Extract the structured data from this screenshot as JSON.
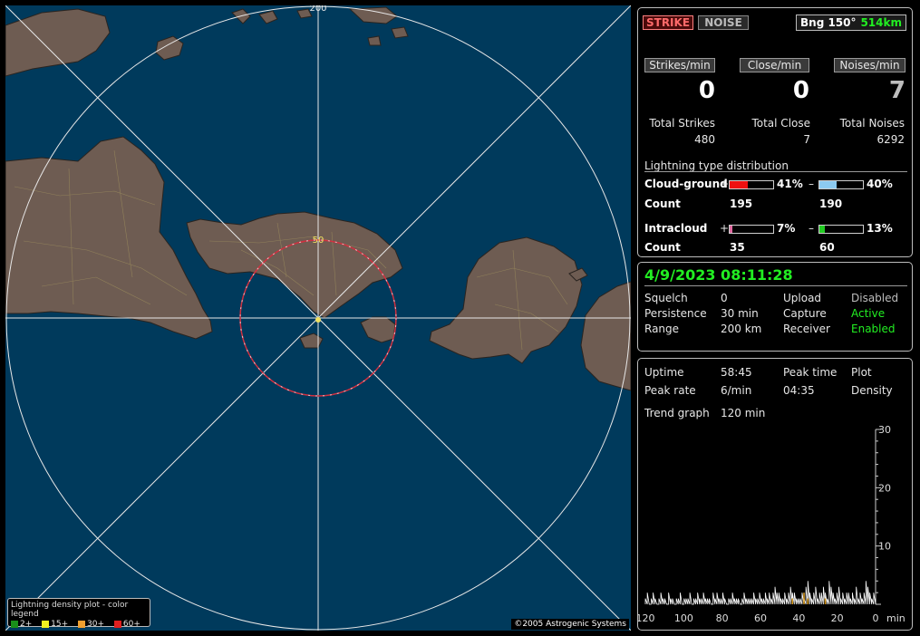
{
  "map": {
    "range_label_outer": "200",
    "range_label_inner": "50",
    "copyright": "©2005 Astrogenic Systems",
    "legend": {
      "title": "Lightning density plot - color legend",
      "items": [
        {
          "label": "2+",
          "color": "#1a8f1a"
        },
        {
          "label": "15+",
          "color": "#f0f020"
        },
        {
          "label": "30+",
          "color": "#f0a030"
        },
        {
          "label": "60+",
          "color": "#e02020"
        }
      ]
    },
    "colors": {
      "water": "#003a5c",
      "land": "#6e5c52",
      "inner_ring": "#d03040"
    }
  },
  "top": {
    "strike_label": "STRIKE",
    "noise_label": "NOISE",
    "bearing_text": "Bng 150°",
    "distance_text": "514km"
  },
  "rates": {
    "strikes_label": "Strikes/min",
    "close_label": "Close/min",
    "noises_label": "Noises/min",
    "strikes_value": "0",
    "close_value": "0",
    "noises_value": "7"
  },
  "totals": {
    "strikes_label": "Total Strikes",
    "close_label": "Total Close",
    "noises_label": "Total Noises",
    "strikes_value": "480",
    "close_value": "7",
    "noises_value": "6292"
  },
  "distribution": {
    "title": "Lightning type distribution",
    "cg_label": "Cloud-ground",
    "ic_label": "Intracloud",
    "count_label": "Count",
    "plus": "+",
    "minus": "–",
    "cg_pos_pct": "41%",
    "cg_neg_pct": "40%",
    "cg_pos_count": "195",
    "cg_neg_count": "190",
    "ic_pos_pct": "7%",
    "ic_neg_pct": "13%",
    "ic_pos_count": "35",
    "ic_neg_count": "60",
    "cg_pos_fraction": 0.41,
    "cg_neg_fraction": 0.4,
    "ic_pos_fraction": 0.07,
    "ic_neg_fraction": 0.13
  },
  "status": {
    "datetime": "4/9/2023 08:11:28",
    "squelch_label": "Squelch",
    "squelch_value": "0",
    "persistence_label": "Persistence",
    "persistence_value": "30 min",
    "range_label": "Range",
    "range_value": "200 km",
    "upload_label": "Upload",
    "upload_value": "Disabled",
    "capture_label": "Capture",
    "capture_value": "Active",
    "receiver_label": "Receiver",
    "receiver_value": "Enabled"
  },
  "stats": {
    "uptime_label": "Uptime",
    "uptime_value": "58:45",
    "peak_time_label": "Peak time",
    "peak_time_value": "04:35",
    "plot_label": "Plot",
    "plot_value": "Density",
    "peak_rate_label": "Peak rate",
    "peak_rate_value": "6/min",
    "trend_label": "Trend graph",
    "trend_value": "120 min"
  },
  "trend": {
    "x_ticks": [
      "120",
      "100",
      "80",
      "60",
      "40",
      "20",
      "0"
    ],
    "x_unit": "min",
    "y_ticks": [
      "30",
      "20",
      "10"
    ],
    "ylim": [
      0,
      30
    ],
    "xlim": [
      120,
      0
    ],
    "noise_counts": [
      1,
      2,
      0,
      1,
      2,
      1,
      0,
      1,
      2,
      1,
      1,
      0,
      2,
      1,
      1,
      0,
      1,
      1,
      2,
      0,
      1,
      1,
      1,
      2,
      0,
      1,
      1,
      2,
      1,
      1,
      2,
      1,
      1,
      1,
      0,
      2,
      1,
      2,
      1,
      1,
      2,
      1,
      0,
      1,
      1,
      2,
      1,
      1,
      1,
      0,
      1,
      2,
      1,
      1,
      1,
      1,
      2,
      1,
      1,
      2,
      1,
      1,
      2,
      1,
      2,
      1,
      2,
      3,
      2,
      2,
      1,
      1,
      2,
      1,
      2,
      3,
      2,
      2,
      1,
      1,
      1,
      2,
      1,
      3,
      4,
      2,
      1,
      2,
      3,
      1,
      2,
      2,
      3,
      2,
      1,
      4,
      3,
      2,
      1,
      2,
      3,
      1,
      2,
      1,
      2,
      2,
      1,
      2,
      1,
      3,
      1,
      2,
      1,
      2,
      4,
      3,
      2,
      1,
      2,
      1
    ],
    "strike_counts": [
      0,
      0,
      0,
      0,
      0,
      0,
      0,
      0,
      0,
      0,
      0,
      0,
      0,
      0,
      0,
      0,
      0,
      0,
      0,
      0,
      0,
      0,
      0,
      0,
      0,
      0,
      0,
      0,
      0,
      0,
      0,
      0,
      0,
      0,
      0,
      0,
      0,
      0,
      0,
      0,
      0,
      0,
      0,
      0,
      0,
      0,
      0,
      0,
      0,
      0,
      0,
      0,
      0,
      0,
      0,
      0,
      0,
      0,
      0,
      0,
      0,
      0,
      0,
      0,
      0,
      0,
      0,
      0,
      0,
      0,
      0,
      0,
      0,
      0,
      0,
      0,
      1,
      0,
      0,
      0,
      0,
      0,
      2,
      0,
      1,
      0,
      0,
      0,
      0,
      0,
      0,
      0,
      0,
      1,
      0,
      0,
      0,
      0,
      0,
      0,
      0,
      0,
      0,
      0,
      0,
      0,
      0,
      0,
      0,
      0,
      0,
      0,
      0,
      0,
      0,
      0,
      0,
      0,
      0,
      0
    ]
  }
}
